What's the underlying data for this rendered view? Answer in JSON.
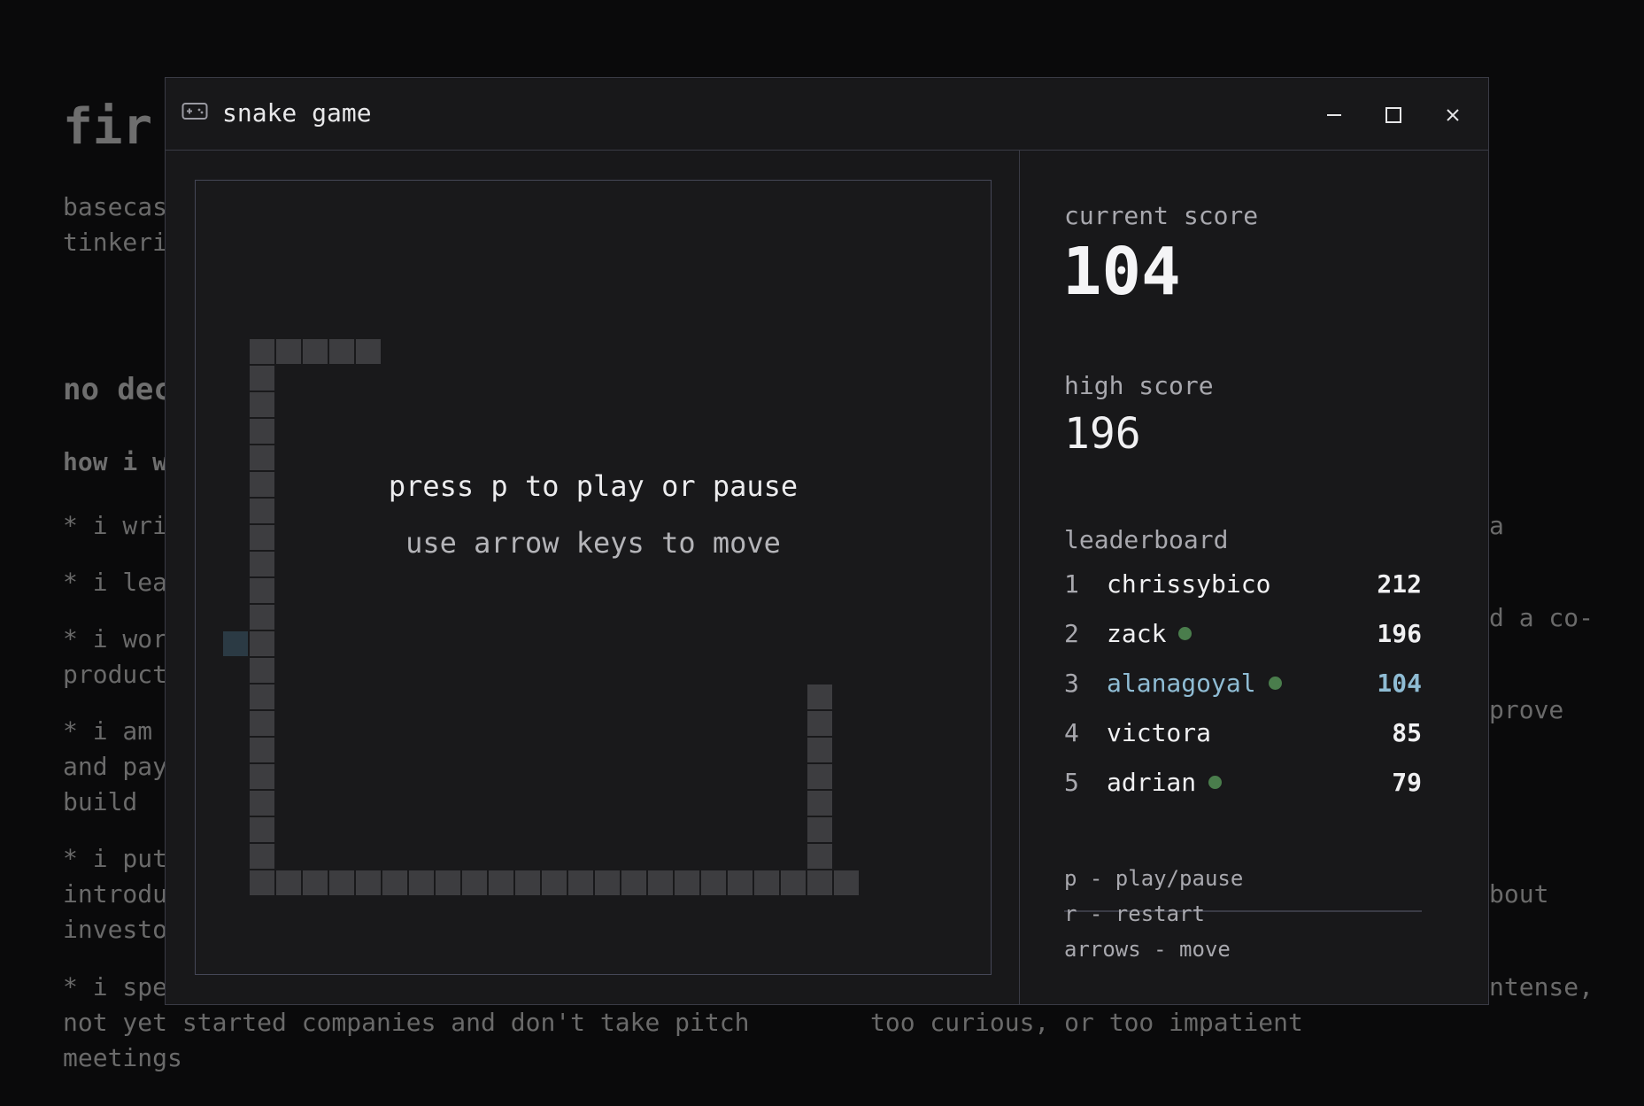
{
  "background": {
    "heading": "fir",
    "intro_line1": "basecas",
    "intro_line2": "tinkeri",
    "subheading": "no dec",
    "subsubheading": "how i w",
    "item1": "* i wri",
    "item2": "* i lea",
    "item3_line1": "* i wor",
    "item3_line2": "product",
    "item4_line1": "* i am",
    "item4_line2": "and pay",
    "item4_line3": "build",
    "item5_line1": "* i put",
    "item5_line2": "introdu",
    "item5_line3": "investo",
    "item6_line1": "* i spe",
    "item6_line2": "not yet started companies and don't take pitch",
    "item6_line3": "meetings",
    "right_frag1": "a",
    "right_frag2": "d a co-",
    "right_frag3": "prove",
    "right_frag4": "bout",
    "right_frag5": "ntense,",
    "right_line": "too curious, or too impatient"
  },
  "window": {
    "title": "snake game",
    "icon": "gamepad-icon",
    "controls": [
      "minimize-icon",
      "maximize-icon",
      "close-icon"
    ]
  },
  "game": {
    "message_primary": "press p to play or pause",
    "message_secondary": "use arrow keys to move",
    "snake_color": "#3d3d40",
    "food_color": "#2b3a44"
  },
  "sidebar": {
    "current_score_label": "current score",
    "current_score": "104",
    "high_score_label": "high score",
    "high_score": "196",
    "leaderboard_label": "leaderboard",
    "leaderboard": [
      {
        "rank": "1",
        "name": "chrissybico",
        "score": "212",
        "online": false,
        "current_user": false
      },
      {
        "rank": "2",
        "name": "zack",
        "score": "196",
        "online": true,
        "current_user": false
      },
      {
        "rank": "3",
        "name": "alanagoyal",
        "score": "104",
        "online": true,
        "current_user": true
      },
      {
        "rank": "4",
        "name": "victora",
        "score": "85",
        "online": false,
        "current_user": false
      },
      {
        "rank": "5",
        "name": "adrian",
        "score": "79",
        "online": true,
        "current_user": false
      }
    ],
    "help": [
      "p - play/pause",
      "r - restart",
      "arrows - move"
    ],
    "online_color": "#4a7d4c",
    "highlight_color": "#8fbcd4"
  }
}
